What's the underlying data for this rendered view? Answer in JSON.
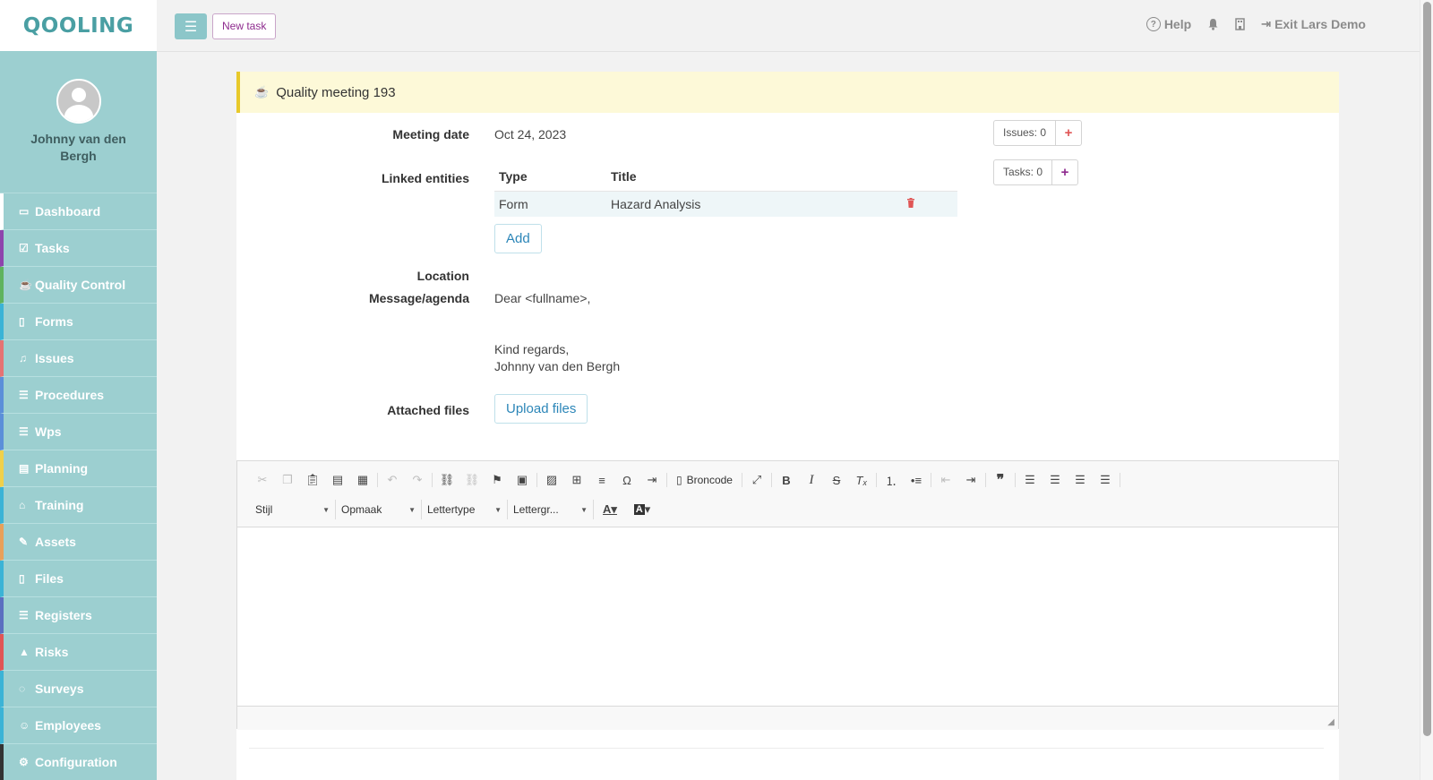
{
  "app": {
    "logo": "QOOLING"
  },
  "user": {
    "name": "Johnny van den Bergh"
  },
  "nav": [
    {
      "label": "Dashboard",
      "icon": "monitor-icon",
      "glyph": "▭",
      "color": "#ffffff"
    },
    {
      "label": "Tasks",
      "icon": "check-square-icon",
      "glyph": "☑",
      "color": "#8e44ad"
    },
    {
      "label": "Quality Control",
      "icon": "coffee-icon",
      "glyph": "☕",
      "color": "#5fb35f"
    },
    {
      "label": "Forms",
      "icon": "file-icon",
      "glyph": "▯",
      "color": "#3bb3d6"
    },
    {
      "label": "Issues",
      "icon": "bell-icon",
      "glyph": "♫",
      "color": "#e57373"
    },
    {
      "label": "Procedures",
      "icon": "list-icon",
      "glyph": "☰",
      "color": "#5b8fd9"
    },
    {
      "label": "Wps",
      "icon": "list-icon",
      "glyph": "☰",
      "color": "#5b8fd9"
    },
    {
      "label": "Planning",
      "icon": "calendar-icon",
      "glyph": "▤",
      "color": "#f0d04a"
    },
    {
      "label": "Training",
      "icon": "graduation-cap-icon",
      "glyph": "⌂",
      "color": "#3bb3d6"
    },
    {
      "label": "Assets",
      "icon": "wrench-icon",
      "glyph": "✎",
      "color": "#e8a05a"
    },
    {
      "label": "Files",
      "icon": "file-icon",
      "glyph": "▯",
      "color": "#3bb3d6"
    },
    {
      "label": "Registers",
      "icon": "list-icon",
      "glyph": "☰",
      "color": "#5b6fc0"
    },
    {
      "label": "Risks",
      "icon": "warning-icon",
      "glyph": "▲",
      "color": "#e05555"
    },
    {
      "label": "Surveys",
      "icon": "comment-icon",
      "glyph": "◌",
      "color": "#3bb3d6"
    },
    {
      "label": "Employees",
      "icon": "users-icon",
      "glyph": "☺",
      "color": "#3bb3d6"
    },
    {
      "label": "Configuration",
      "icon": "gear-icon",
      "glyph": "⚙",
      "color": "#333333"
    }
  ],
  "topbar": {
    "new_task": "New task",
    "help": "Help",
    "exit": "Exit Lars Demo"
  },
  "meeting": {
    "title": "Quality meeting 193",
    "date_label": "Meeting date",
    "date": "Oct 24, 2023",
    "linked_label": "Linked entities",
    "col_type": "Type",
    "col_title": "Title",
    "entities": [
      {
        "type": "Form",
        "title": "Hazard Analysis"
      }
    ],
    "add": "Add",
    "location_label": "Location",
    "message_label": "Message/agenda",
    "message_greeting": "Dear <fullname>,",
    "message_closing": "Kind regards,",
    "message_signature": "Johnny van den Bergh",
    "files_label": "Attached files",
    "upload": "Upload files",
    "issues_badge": "Issues: 0",
    "tasks_badge": "Tasks: 0"
  },
  "editor": {
    "source_label": "Broncode",
    "style": "Stijl",
    "format": "Opmaak",
    "font": "Lettertype",
    "size": "Lettergr..."
  },
  "colors": {
    "accent": "#9ccfd0",
    "header_bg": "#fdf9d8",
    "header_border": "#e8c92b",
    "link": "#2c86b8",
    "danger": "#e05555",
    "purple": "#8e2b8e"
  }
}
